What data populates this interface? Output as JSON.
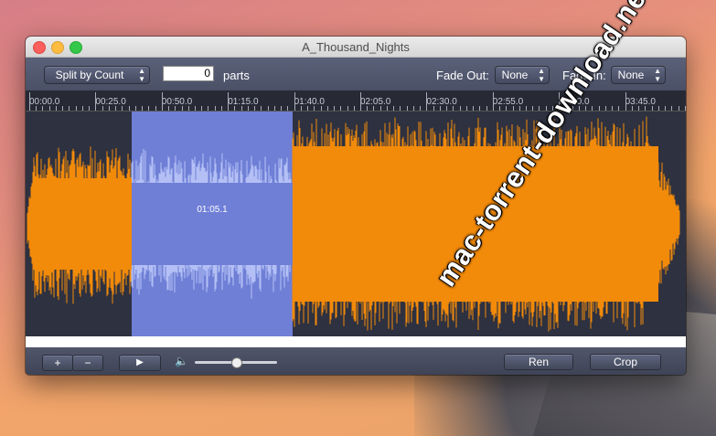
{
  "window": {
    "title": "A_Thousand_Nights"
  },
  "toolbar": {
    "split_mode": "Split by Count",
    "count_value": "0",
    "parts_label": "parts",
    "fade_out_label": "Fade Out:",
    "fade_out_value": "None",
    "fade_in_label": "Fade In:",
    "fade_in_value": "None"
  },
  "timeline": {
    "ticks": [
      "00:00.0",
      "00:25.0",
      "00:50.0",
      "01:15.0",
      "01:40.0",
      "02:05.0",
      "02:30.0",
      "02:55.0",
      "03:20.0",
      "03:45.0"
    ]
  },
  "waveform": {
    "selection_label": "01:05.1",
    "wave_color": "#f28a0a",
    "selection_color": "#6f7fd6",
    "selection_wave_color": "#b4c0f5"
  },
  "bottombar": {
    "zoom_in": "+",
    "zoom_out": "−",
    "play": "▶",
    "volume_icon": "🔈",
    "volume_level": 0.5,
    "rename_label": "Ren",
    "crop_label": "Crop"
  },
  "watermark": {
    "text": "mac-torrent-download.net"
  }
}
